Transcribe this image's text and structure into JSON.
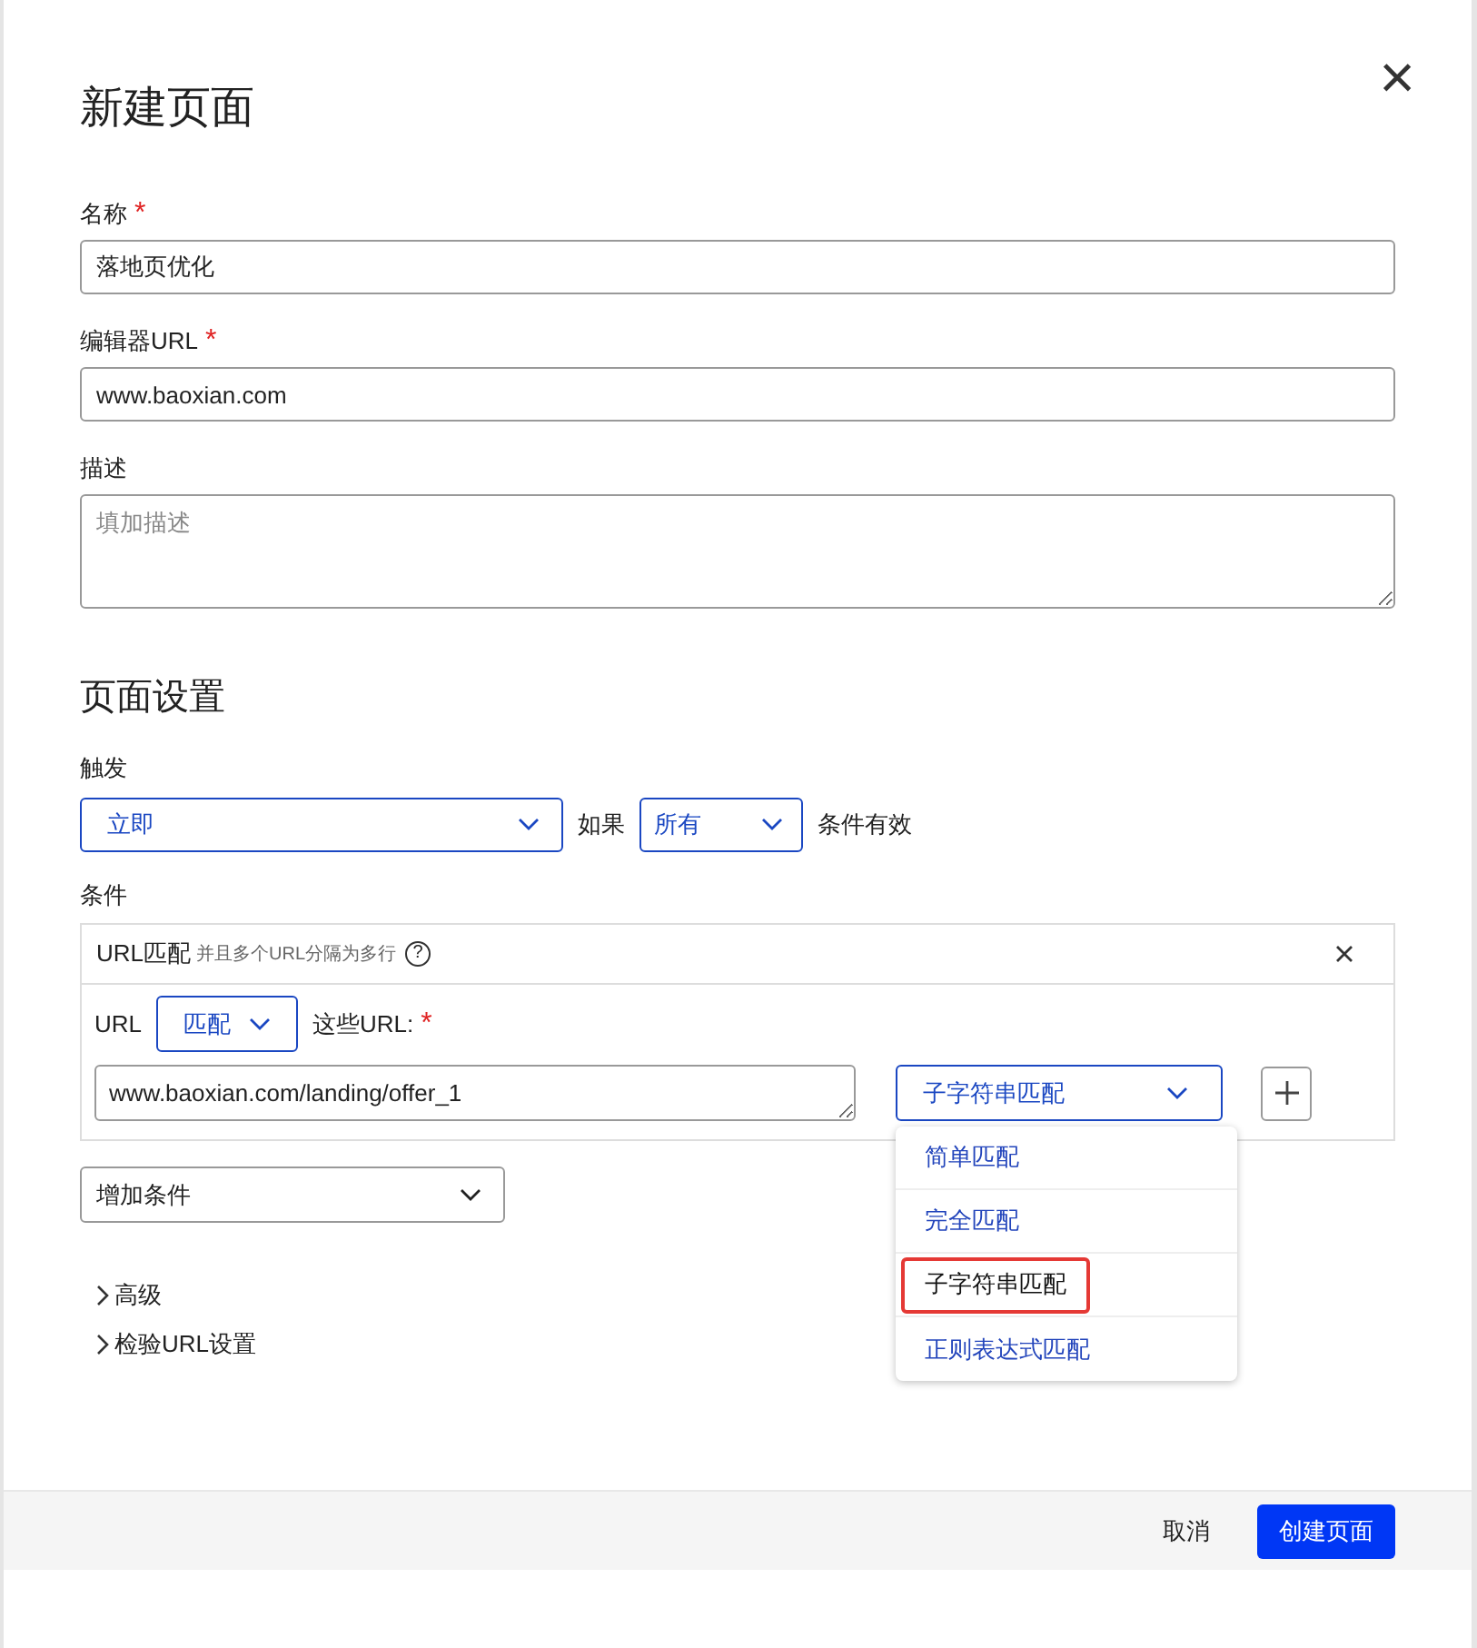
{
  "dialog": {
    "title": "新建页面",
    "close_icon": "×"
  },
  "fields": [
    {
      "label": "名称",
      "required_mark": "*",
      "value": "落地页优化"
    },
    {
      "label": "编辑器URL",
      "required_mark": "*",
      "value": "www.baoxian.com"
    },
    {
      "label": "描述",
      "placeholder": "填加描述"
    }
  ],
  "section_title": "页面设置",
  "trigger": {
    "label": "触发",
    "value": "立即",
    "if_label": "如果",
    "match_value": "所有",
    "suffix": "条件有效"
  },
  "conditions": {
    "label": "条件",
    "title": "URL匹配",
    "hint": "并且多个URL分隔为多行",
    "help_icon": "?",
    "url_label": "URL",
    "match_select": "匹配",
    "these_label": "这些URL:",
    "required_mark": "*",
    "url_value": "www.baoxian.com/landing/offer_1",
    "match_type": "子字符串匹配",
    "options": [
      {
        "label": "简单匹配",
        "selected": false
      },
      {
        "label": "完全匹配",
        "selected": false
      },
      {
        "label": "子字符串匹配",
        "selected": true
      },
      {
        "label": "正则表达式匹配",
        "selected": false
      }
    ]
  },
  "add_condition": "增加条件",
  "expanders": [
    {
      "label": "高级",
      "expanded": false
    },
    {
      "label": "检验URL设置",
      "expanded": false
    }
  ],
  "footer": {
    "cancel": "取消",
    "submit": "创建页面"
  }
}
